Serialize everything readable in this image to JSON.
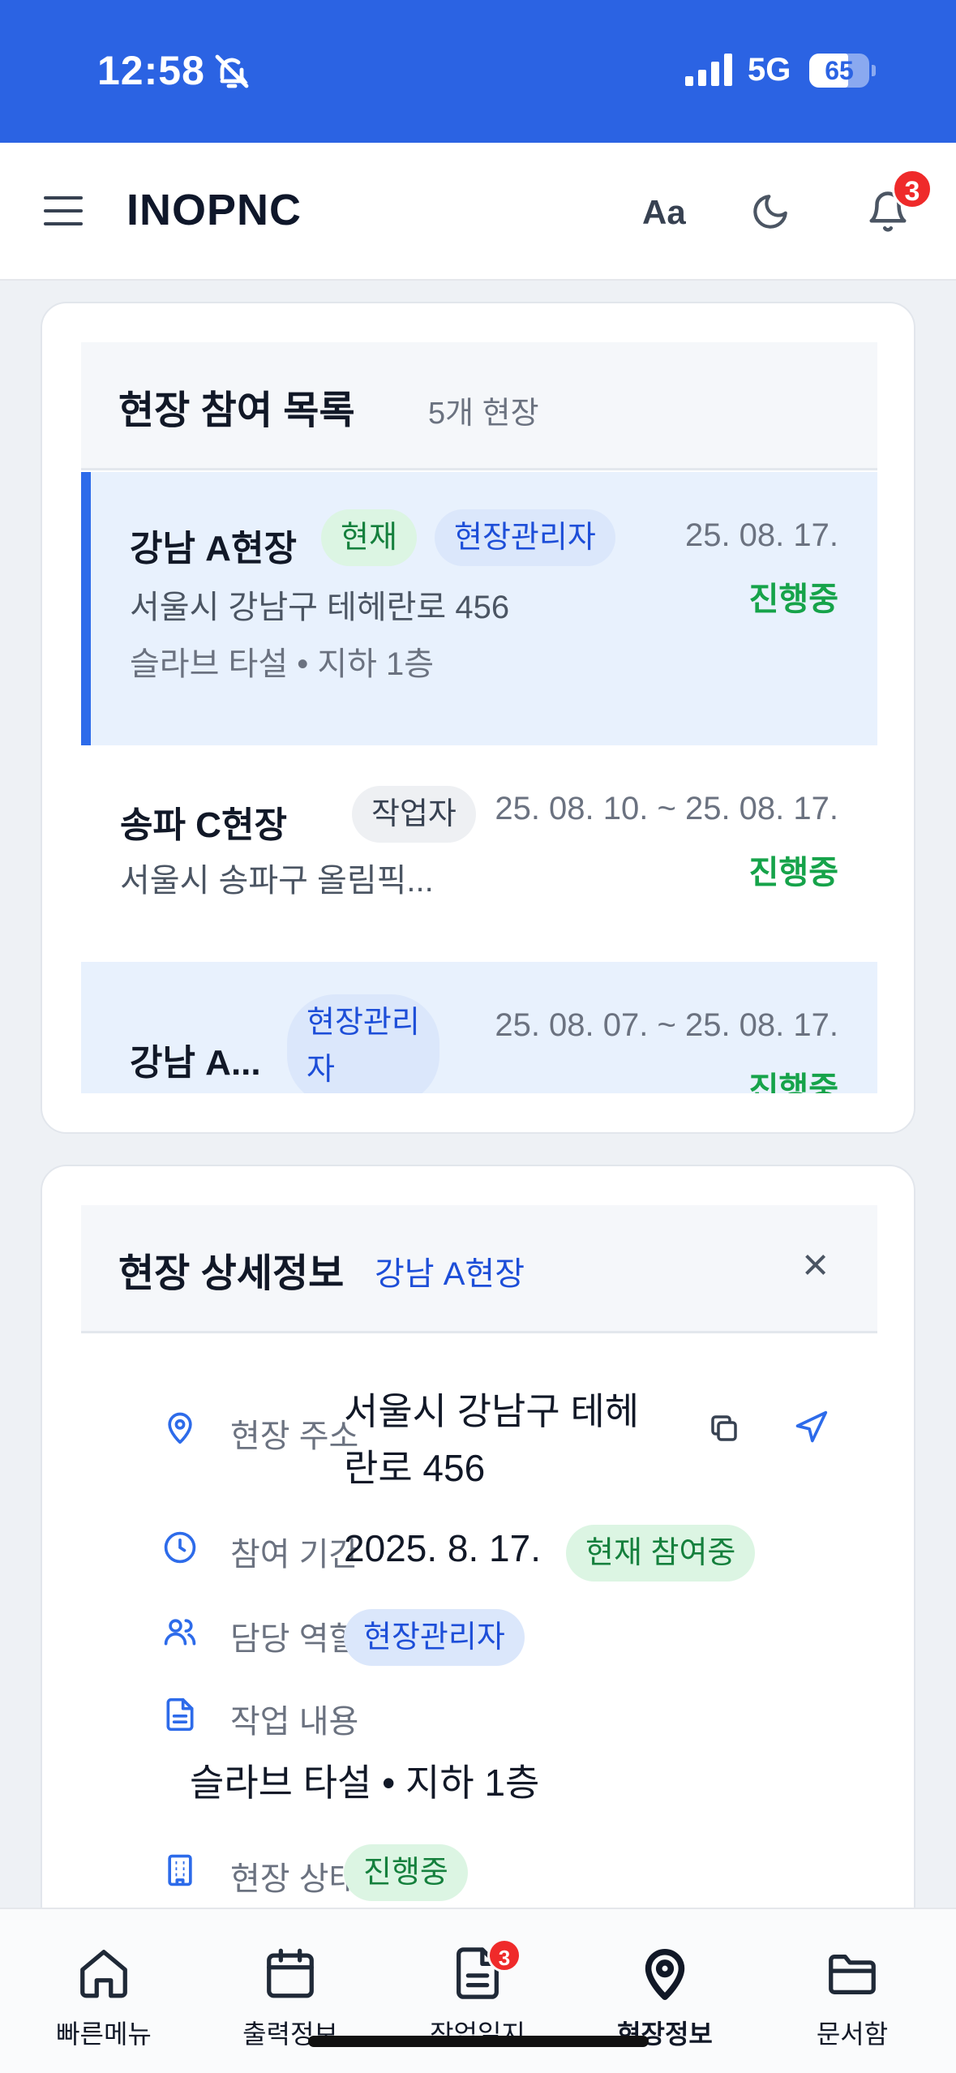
{
  "status_bar": {
    "time": "12:58",
    "network": "5G",
    "battery": "65"
  },
  "header": {
    "logo": "INOPNC",
    "font_button": "Aa",
    "notification_count": "3"
  },
  "site_list": {
    "title": "현장 참여 목록",
    "count": "5개 현장",
    "items": [
      {
        "name": "강남 A현장",
        "badges": [
          "현재",
          "현장관리자"
        ],
        "date": "25. 08. 17.",
        "status": "진행중",
        "address": "서울시 강남구 테헤란로 456",
        "work": "슬라브 타설 • 지하 1층"
      },
      {
        "name": "송파 C현장",
        "badges": [
          "작업자"
        ],
        "date": "25. 08. 10. ~ 25. 08. 17.",
        "status": "진행중",
        "address": "서울시 송파구 올림픽..."
      },
      {
        "name": "강남 A...",
        "badges": [
          "현장관리\n자"
        ],
        "date": "25. 08. 07. ~ 25. 08. 17.",
        "status": "진행중"
      }
    ]
  },
  "site_detail": {
    "title": "현장 상세정보",
    "site_name": "강남 A현장",
    "close": "×",
    "address_label": "현장 주소",
    "address_line1": "서울시 강남구 테헤",
    "address_line2": "란로 456",
    "period_label": "참여 기간",
    "period_value": "2025. 8. 17.",
    "period_badge": "현재 참여중",
    "role_label": "담당 역할",
    "role_value": "현장관리자",
    "work_label": "작업 내용",
    "work_value": "슬라브 타설 • 지하 1층",
    "status_label": "현장 상태",
    "status_value": "진행중"
  },
  "bottom_nav": {
    "items": [
      {
        "label": "빠른메뉴",
        "icon": "home-icon"
      },
      {
        "label": "출력정보",
        "icon": "calendar-icon"
      },
      {
        "label": "작업일지",
        "icon": "document-icon",
        "badge": "3"
      },
      {
        "label": "현장정보",
        "icon": "map-pin-icon",
        "active": true
      },
      {
        "label": "문서함",
        "icon": "folder-icon"
      }
    ]
  },
  "colors": {
    "brand": "#2b63e3",
    "success": "#16a34a",
    "badge": "#ef2a2a"
  }
}
